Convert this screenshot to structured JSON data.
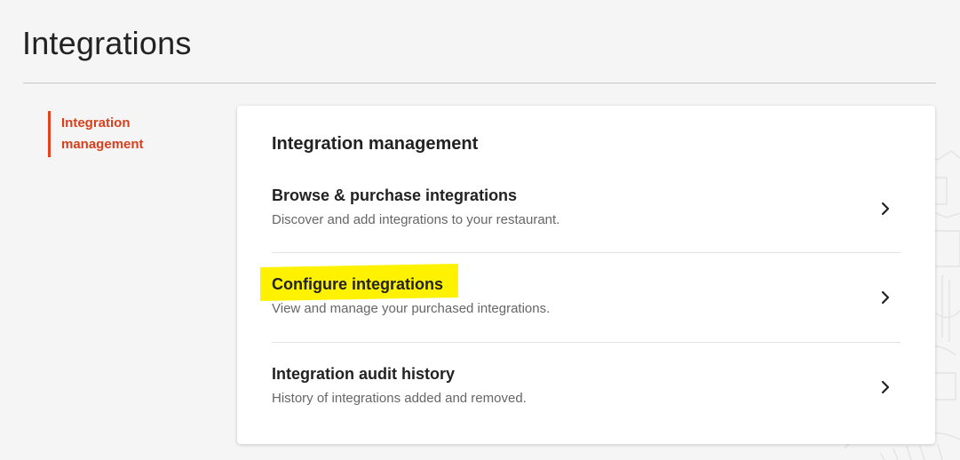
{
  "page": {
    "title": "Integrations"
  },
  "sidebar": {
    "items": [
      {
        "label": "Integration management",
        "active": true
      }
    ]
  },
  "card": {
    "title": "Integration management",
    "items": [
      {
        "title": "Browse & purchase integrations",
        "description": "Discover and add integrations to your restaurant.",
        "icon": "chevron-right-icon"
      },
      {
        "title": "Configure integrations",
        "description": "View and manage your purchased integrations.",
        "icon": "chevron-right-icon",
        "highlighted": true
      },
      {
        "title": "Integration audit history",
        "description": "History of integrations added and removed.",
        "icon": "chevron-right-icon"
      }
    ]
  },
  "colors": {
    "accent": "#e2441f",
    "highlight": "#fff200",
    "background": "#f5f5f5"
  }
}
